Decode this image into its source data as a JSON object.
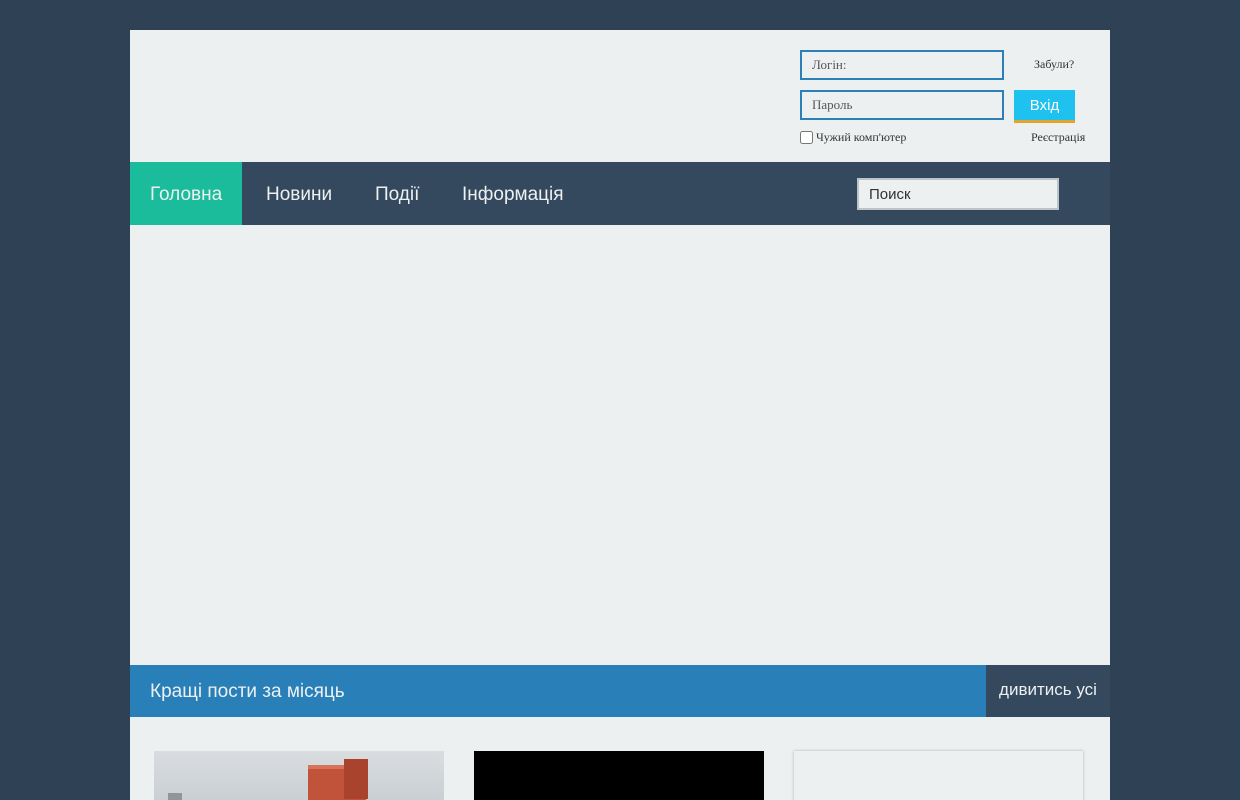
{
  "login": {
    "login_placeholder": "Логін:",
    "password_placeholder": "Пароль",
    "forgot_label": "Забули?",
    "submit_label": "Вхід",
    "remember_label": "Чужий комп'ютер",
    "register_label": "Реєстрація"
  },
  "nav": {
    "items": [
      {
        "label": "Головна",
        "active": true
      },
      {
        "label": "Новини"
      },
      {
        "label": "Події"
      },
      {
        "label": "Інформація"
      }
    ],
    "search_placeholder": "Поиск"
  },
  "section": {
    "title": "Кращі пости за місяць",
    "view_all_label": "дивитись усі"
  },
  "colors": {
    "background": "#2f4154",
    "nav": "#34495e",
    "active_nav": "#1abc9c",
    "section_bar": "#2980b9",
    "login_button": "#1fc1ee",
    "login_button_underline": "#e2a42a"
  }
}
